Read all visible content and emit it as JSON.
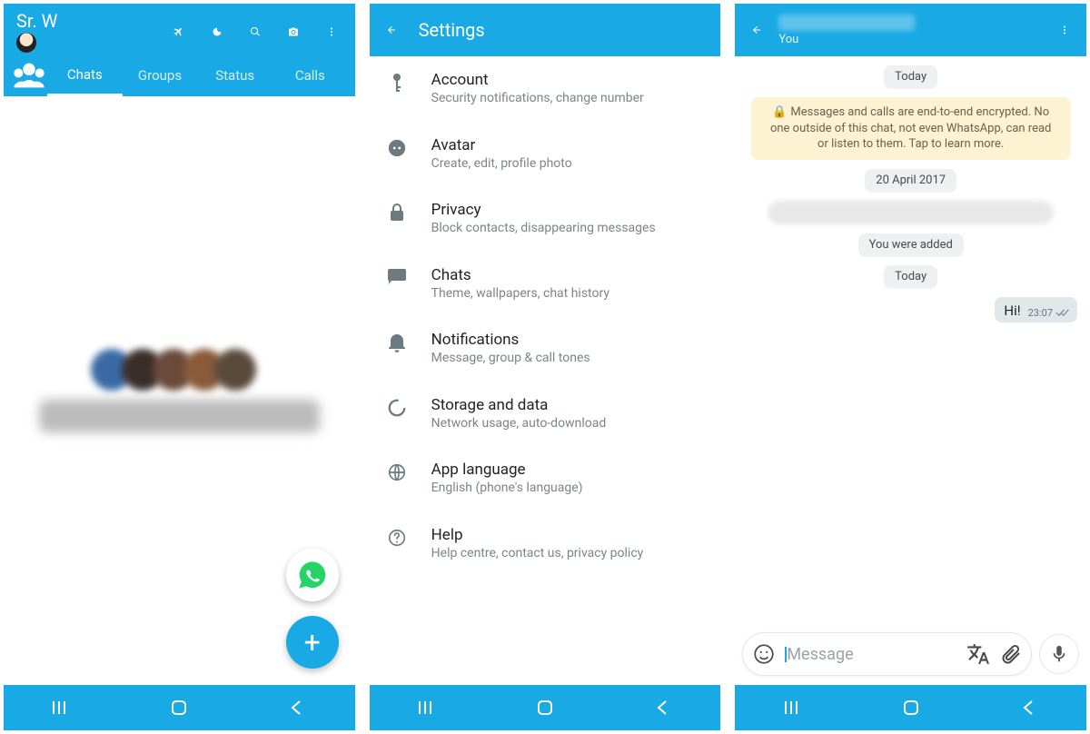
{
  "colors": {
    "primary": "#19a9e5",
    "whatsapp_green": "#25D366"
  },
  "phone1": {
    "user_name": "Sr. W",
    "tabs": {
      "chats": "Chats",
      "groups": "Groups",
      "status": "Status",
      "calls": "Calls"
    }
  },
  "phone2": {
    "title": "Settings",
    "items": [
      {
        "title": "Account",
        "sub": "Security notifications, change number"
      },
      {
        "title": "Avatar",
        "sub": "Create, edit, profile photo"
      },
      {
        "title": "Privacy",
        "sub": "Block contacts, disappearing messages"
      },
      {
        "title": "Chats",
        "sub": "Theme, wallpapers, chat history"
      },
      {
        "title": "Notifications",
        "sub": "Message, group & call tones"
      },
      {
        "title": "Storage and data",
        "sub": "Network usage, auto-download"
      },
      {
        "title": "App language",
        "sub": "English (phone's language)"
      },
      {
        "title": "Help",
        "sub": "Help centre, contact us, privacy policy"
      }
    ]
  },
  "phone3": {
    "subtitle": "You",
    "chips": {
      "today": "Today",
      "date1": "20 April 2017",
      "added": "You were added"
    },
    "encryption_notice": "Messages and calls are end-to-end encrypted. No one outside of this chat, not even WhatsApp, can read or listen to them. Tap to learn more.",
    "msg_out": {
      "text": "Hi!",
      "time": "23:07"
    },
    "input_placeholder": "Message"
  }
}
